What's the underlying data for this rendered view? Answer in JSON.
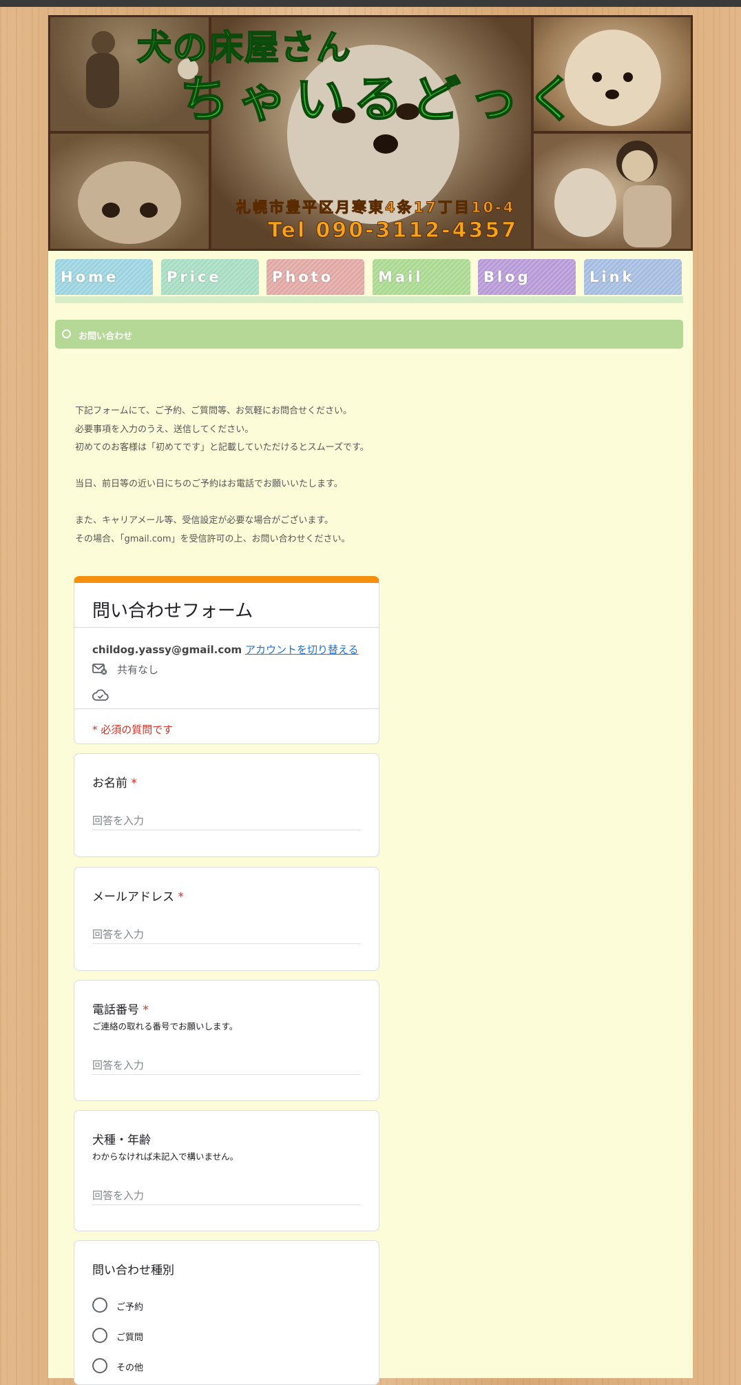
{
  "banner": {
    "title_small": "犬の床屋さん",
    "title_large": "ちゃいるどっく",
    "address": "札幌市豊平区月寒東4条17丁目10-4",
    "tel": "Tel 090-3112-4357"
  },
  "nav": [
    {
      "label": "Home",
      "color": "#9ad3df"
    },
    {
      "label": "Price",
      "color": "#a6dcc1"
    },
    {
      "label": "Photo",
      "color": "#e0a7a3"
    },
    {
      "label": "Mail",
      "color": "#a9d98f"
    },
    {
      "label": "Blog",
      "color": "#b699d6"
    },
    {
      "label": "Link",
      "color": "#a4bce0"
    }
  ],
  "section": {
    "title": "お問い合わせ"
  },
  "intro": {
    "lines": [
      "下記フォームにて、ご予約、ご質問等、お気軽にお問合せください。",
      "必要事項を入力のうえ、送信してください。",
      "初めてのお客様は「初めてです」と記載していただけるとスムーズです。",
      "",
      "当日、前日等の近い日にちのご予約はお電話でお願いいたします。",
      "",
      "また、キャリアメール等、受信設定が必要な場合がございます。",
      "その場合、「gmail.com」を受信許可の上、お問い合わせください。"
    ]
  },
  "form": {
    "accent_color": "#f5900f",
    "title": "問い合わせフォーム",
    "account_email": "childog.yassy@gmail.com",
    "switch_account": "アカウントを切り替える",
    "not_shared": "共有なし",
    "required_note": "* 必須の質問です",
    "placeholder": "回答を入力",
    "questions": [
      {
        "label": "お名前",
        "required": "*",
        "help": ""
      },
      {
        "label": "メールアドレス",
        "required": "*",
        "help": ""
      },
      {
        "label": "電話番号",
        "required": "*",
        "help": "ご連絡の取れる番号でお願いします。"
      },
      {
        "label": "犬種・年齢",
        "required": "",
        "help": "わからなければ未記入で構いません。"
      }
    ],
    "inquiry_type": {
      "label": "問い合わせ種別",
      "options": [
        "ご予約",
        "ご質問",
        "その他"
      ]
    }
  }
}
